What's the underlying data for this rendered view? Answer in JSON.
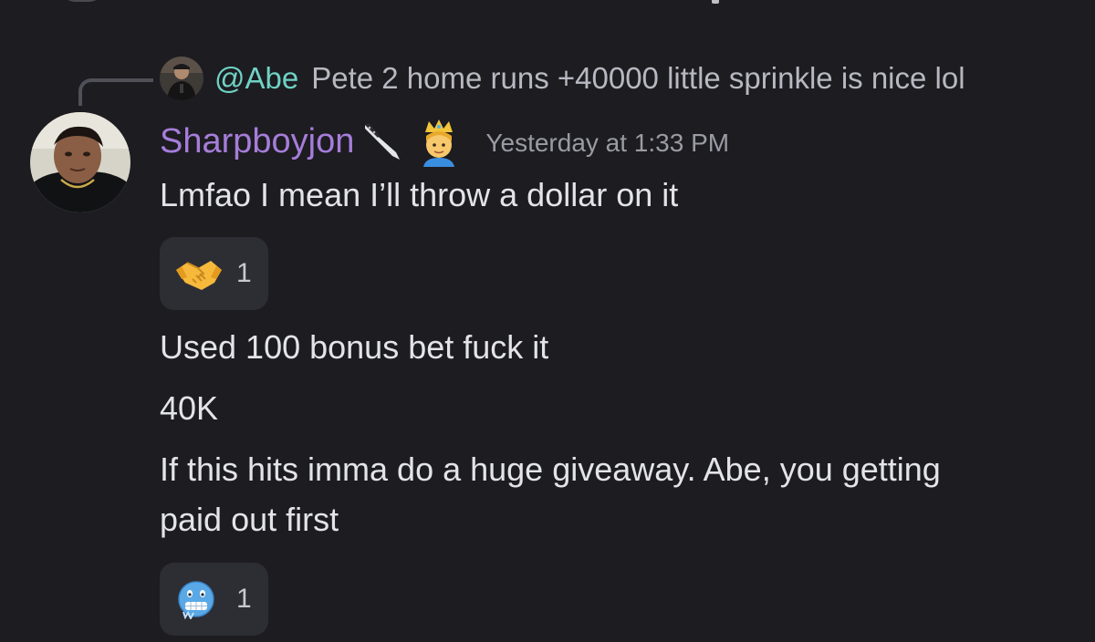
{
  "reply": {
    "mention": "@Abe",
    "text": "Pete 2 home runs +40000 little sprinkle is nice lol"
  },
  "message": {
    "author": "Sharpboyjon",
    "badges": [
      "knife-icon",
      "prince-icon"
    ],
    "timestamp": "Yesterday at 1:33 PM",
    "lines": [
      "Lmfao I mean I’ll throw a dollar on it",
      "Used 100 bonus bet fuck it",
      "40K",
      "If this hits imma do a huge giveaway. Abe, you getting",
      "paid out first"
    ]
  },
  "reactions": [
    {
      "emoji": "handshake-icon",
      "count": "1"
    },
    {
      "emoji": "cold-face-icon",
      "count": "1"
    }
  ],
  "colors": {
    "background": "#1c1c21",
    "author_name": "#a67dd9",
    "mention": "#6fd2c3",
    "reaction_bg": "#2d2d34"
  }
}
